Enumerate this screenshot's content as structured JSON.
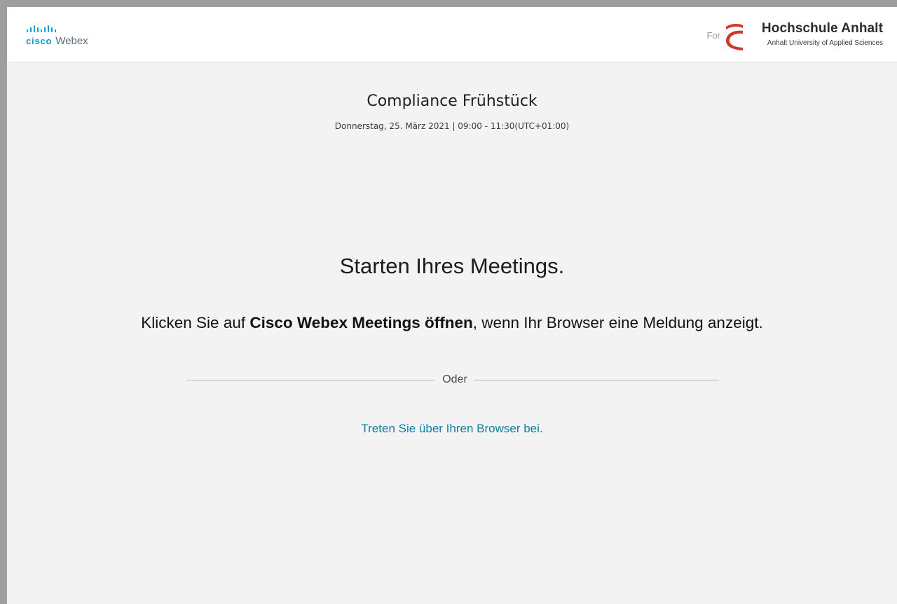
{
  "header": {
    "product_brand": "cisco",
    "product_name": "Webex",
    "for_label": "For",
    "org_name": "Hochschule Anhalt",
    "org_subtitle": "Anhalt University of Applied Sciences"
  },
  "meeting": {
    "title": "Compliance Frühstück",
    "datetime": "Donnerstag, 25. März 2021 | 09:00 - 11:30(UTC+01:00)"
  },
  "main": {
    "heading": "Starten Ihres Meetings.",
    "instruction_prefix": "Klicken Sie auf ",
    "instruction_bold": "Cisco Webex Meetings öffnen",
    "instruction_suffix": ", wenn Ihr Browser eine Meldung anzeigt.",
    "divider_label": "Oder",
    "browser_join_link": "Treten Sie über Ihren Browser bei."
  },
  "colors": {
    "cisco_blue": "#049fd9",
    "link_teal": "#0f7fa3",
    "org_red": "#d0382b",
    "page_background": "#f3f3f3"
  },
  "icons": {
    "cisco_logo": "cisco-bridge-bars-icon",
    "org_logo": "hochschule-anhalt-logo-mark"
  }
}
